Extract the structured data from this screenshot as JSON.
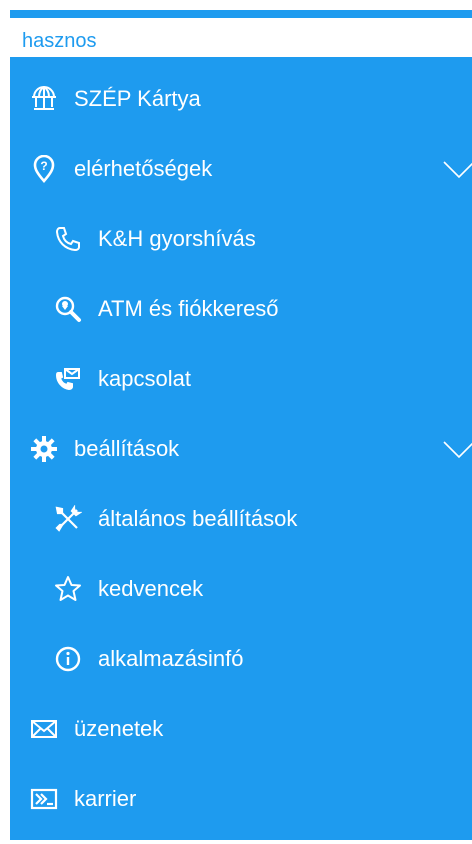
{
  "header": {
    "section": "hasznos"
  },
  "menu": {
    "items": [
      {
        "label": "SZÉP Kártya",
        "icon": "globe-icon"
      },
      {
        "label": "elérhetőségek",
        "icon": "location-pin-icon"
      },
      {
        "label": "K&H gyorshívás",
        "icon": "phone-icon"
      },
      {
        "label": "ATM és fiókkereső",
        "icon": "search-pin-icon"
      },
      {
        "label": "kapcsolat",
        "icon": "phone-mail-icon"
      },
      {
        "label": "beállítások",
        "icon": "gear-icon"
      },
      {
        "label": "általános beállítások",
        "icon": "tools-icon"
      },
      {
        "label": "kedvencek",
        "icon": "star-icon"
      },
      {
        "label": "alkalmazásinfó",
        "icon": "info-icon"
      },
      {
        "label": "üzenetek",
        "icon": "envelope-icon"
      },
      {
        "label": "karrier",
        "icon": "career-icon"
      }
    ]
  },
  "colors": {
    "accent": "#1e9bef",
    "text": "#ffffff"
  }
}
